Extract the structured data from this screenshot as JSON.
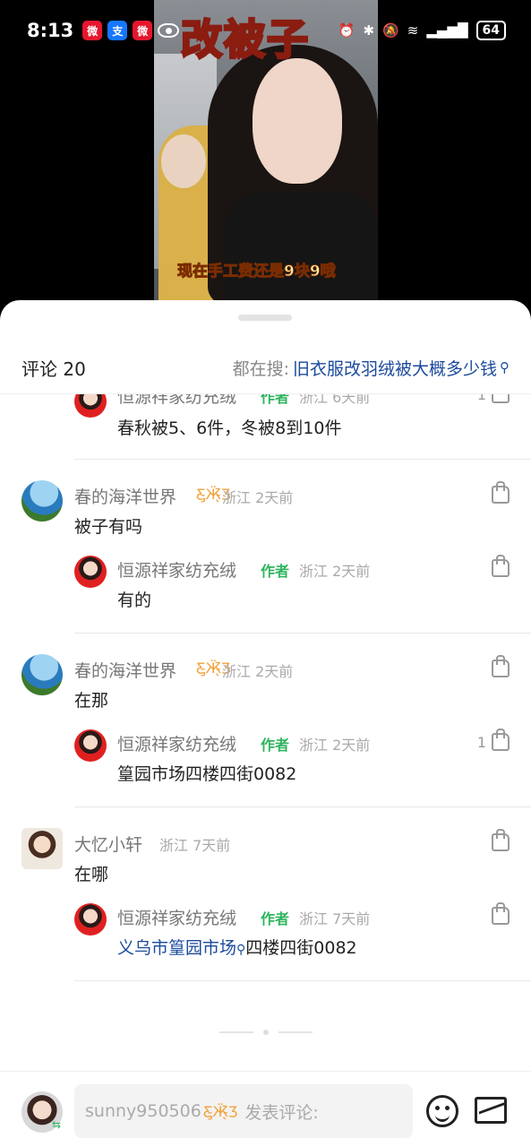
{
  "status_bar": {
    "time": "8:13",
    "apps": [
      "weibo",
      "alipay",
      "weibo",
      "eye"
    ],
    "battery": "64",
    "icons": [
      "alarm-icon",
      "bluetooth-icon",
      "mute-icon",
      "wifi-icon",
      "signal-icon"
    ]
  },
  "video": {
    "title": "改被子",
    "caption": "现在手工费还是9块9哦"
  },
  "sheet": {
    "count_label": "评论 20",
    "search_label": "都在搜:",
    "search_keyword": "旧衣服改羽绒被大概多少钱"
  },
  "comments": [
    {
      "reply": true,
      "name": "恒源祥家纺充绒",
      "tag": "作者",
      "location": "浙江",
      "time": "6天前",
      "text": "春秋被5、6件，冬被8到10件",
      "likes": "1",
      "avatar": "flag"
    },
    {
      "reply": false,
      "name": "春的海洋世界",
      "location": "浙江",
      "time": "2天前",
      "text": "被子有吗",
      "likes": "",
      "avatar": "sea"
    },
    {
      "reply": true,
      "name": "恒源祥家纺充绒",
      "tag": "作者",
      "location": "浙江",
      "time": "2天前",
      "text": "有的",
      "likes": "",
      "avatar": "flag"
    },
    {
      "reply": false,
      "name": "春的海洋世界",
      "location": "浙江",
      "time": "2天前",
      "text": "在那",
      "likes": "",
      "avatar": "sea"
    },
    {
      "reply": true,
      "name": "恒源祥家纺充绒",
      "tag": "作者",
      "location": "浙江",
      "time": "2天前",
      "text": "篁园市场四楼四街0082",
      "likes": "1",
      "avatar": "flag"
    },
    {
      "reply": false,
      "name": "大忆小轩",
      "location": "浙江",
      "time": "7天前",
      "text": "在哪",
      "likes": "",
      "avatar": "girl"
    },
    {
      "reply": true,
      "name": "恒源祥家纺充绒",
      "tag": "作者",
      "location": "浙江",
      "time": "7天前",
      "text_link": "义乌市篁园市场",
      "text_rest": "四楼四街0082",
      "likes": "",
      "avatar": "flag"
    }
  ],
  "input_bar": {
    "username": "sunny950506",
    "placeholder": "发表评论:"
  }
}
